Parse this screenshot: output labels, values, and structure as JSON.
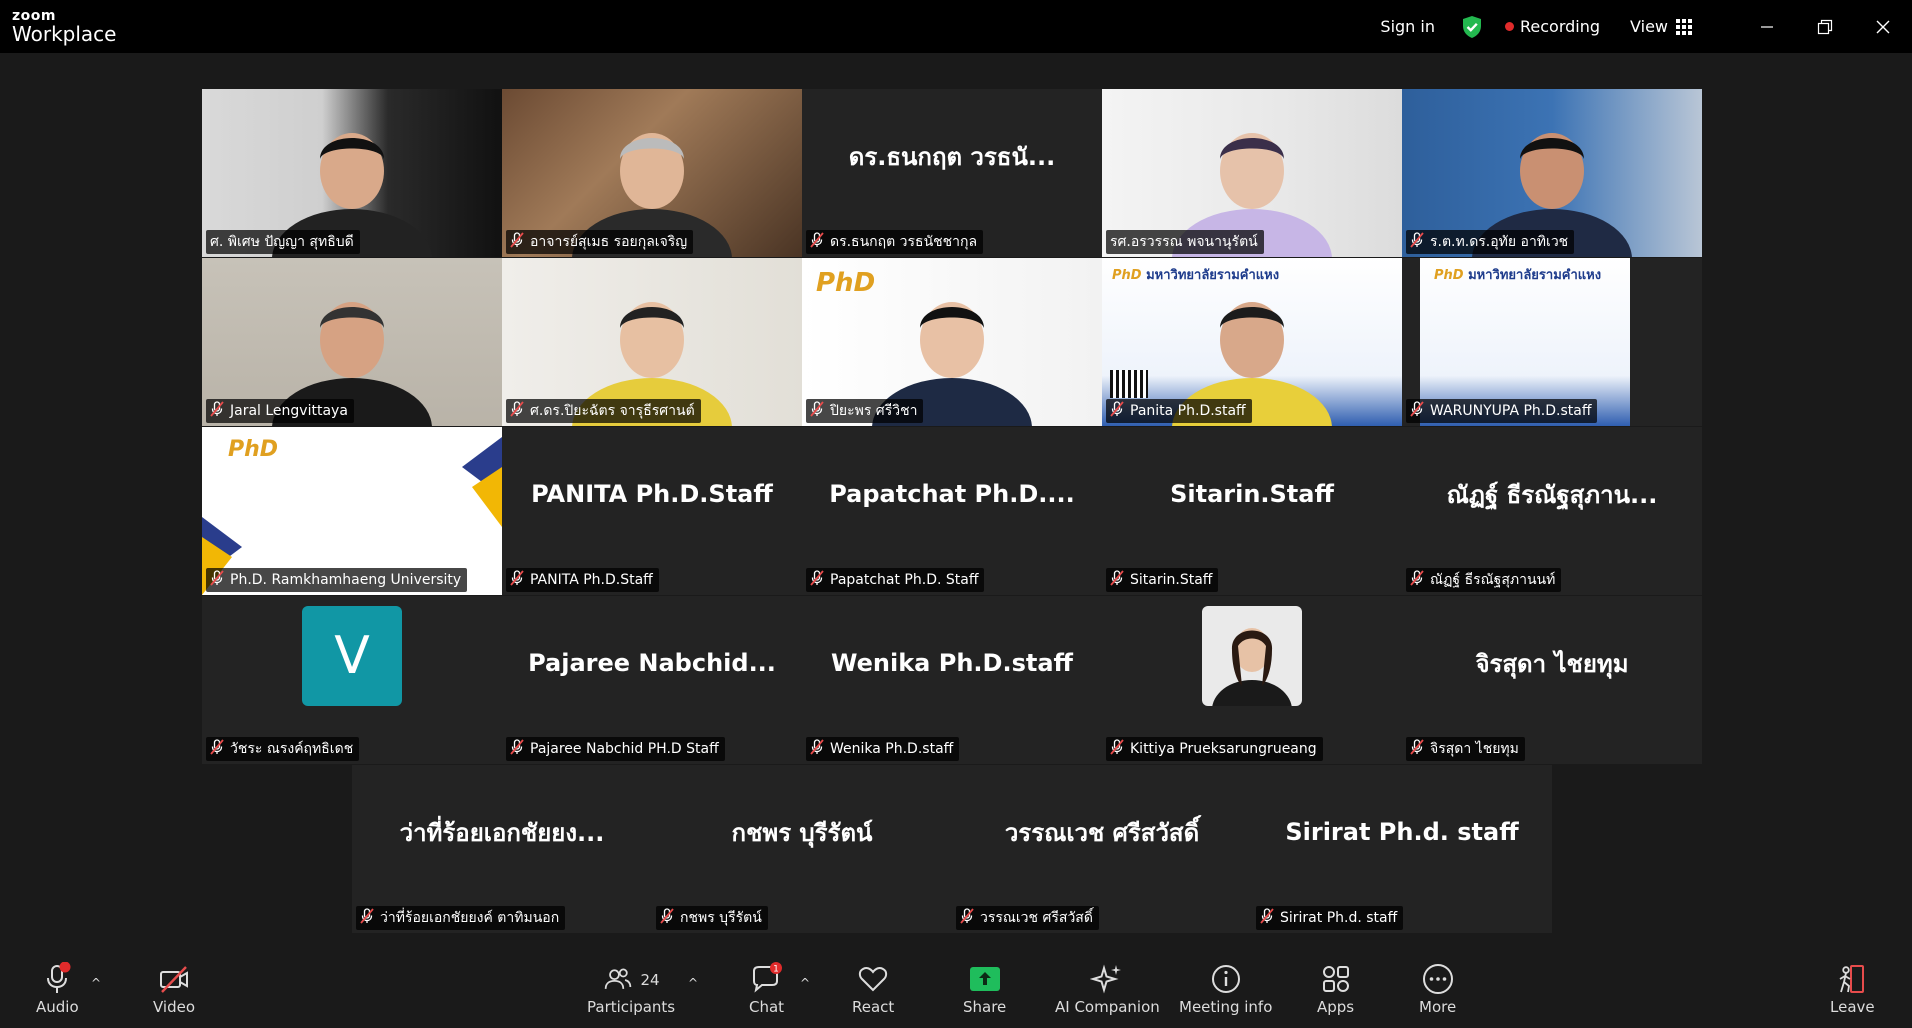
{
  "app": {
    "brand_top": "zoom",
    "brand_bottom": "Workplace"
  },
  "titlebar": {
    "sign_in": "Sign in",
    "recording": "Recording",
    "view": "View"
  },
  "tiles": [
    {
      "big": "",
      "label": "ศ. พิเศษ ปัญญา สุทธิบดี",
      "muted": false
    },
    {
      "big": "",
      "label": "อาจารย์สุเมธ รอยกุลเจริญ",
      "muted": true
    },
    {
      "big": "ดร.ธนกฤต วรธนั...",
      "label": "ดร.ธนกฤต วรธนัชชากุล",
      "muted": true
    },
    {
      "big": "",
      "label": "รศ.อรวรรณ พจนานุรัตน์",
      "muted": false
    },
    {
      "big": "",
      "label": "ร.ต.ท.ดร.อุทัย อาทิเวช",
      "muted": true
    },
    {
      "big": "",
      "label": "Jaral Lengvittaya",
      "muted": true
    },
    {
      "big": "",
      "label": "ศ.ดร.ปิยะฉัตร จารุธีรศานต์",
      "muted": true
    },
    {
      "big": "",
      "label": "ปิยะพร ศรีวิชา",
      "muted": true
    },
    {
      "big": "",
      "label": "Panita Ph.D.staff",
      "muted": true
    },
    {
      "big": "",
      "label": "WARUNYUPA Ph.D.staff",
      "muted": true
    },
    {
      "big": "",
      "label": "Ph.D. Ramkhamhaeng University",
      "muted": true
    },
    {
      "big": "PANITA Ph.D.Staff",
      "label": "PANITA Ph.D.Staff",
      "muted": true
    },
    {
      "big": "Papatchat Ph.D....",
      "label": "Papatchat Ph.D. Staff",
      "muted": true
    },
    {
      "big": "Sitarin.Staff",
      "label": "Sitarin.Staff",
      "muted": true
    },
    {
      "big": "ณัฏฐ์ ธีรณัฐสุภาน...",
      "label": "ณัฏฐ์ ธีรณัฐสุภานนท์",
      "muted": true
    },
    {
      "big": "V",
      "label": "วัชระ ณรงค์ฤทธิเดช",
      "muted": true
    },
    {
      "big": "Pajaree Nabchid...",
      "label": "Pajaree Nabchid PH.D Staff",
      "muted": true
    },
    {
      "big": "Wenika Ph.D.staff",
      "label": "Wenika Ph.D.staff",
      "muted": true
    },
    {
      "big": "",
      "label": "Kittiya Prueksarungrueang",
      "muted": true
    },
    {
      "big": "จิรสุดา ไชยทุม",
      "label": "จิรสุดา ไชยทุม",
      "muted": true
    },
    {
      "big": "ว่าที่ร้อยเอกชัยยง...",
      "label": "ว่าที่ร้อยเอกชัยยงค์ ตาทิมนอก",
      "muted": true
    },
    {
      "big": "กชพร บุรีรัตน์",
      "label": "กชพร บุรีรัตน์",
      "muted": true
    },
    {
      "big": "วรรณเวช ศรีสวัสดิ์",
      "label": "วรรณเวช ศรีสวัสดิ์",
      "muted": true
    },
    {
      "big": "Sirirat Ph.d. staff",
      "label": "Sirirat Ph.d. staff",
      "muted": true
    }
  ],
  "slide": {
    "brand": "PhD",
    "title": "มหาวิทยาลัยรามคำแหง"
  },
  "toolbar": {
    "audio": "Audio",
    "video": "Video",
    "participants": "Participants",
    "participants_count": "24",
    "chat": "Chat",
    "chat_badge": "1",
    "react": "React",
    "share": "Share",
    "ai_companion": "AI Companion",
    "meeting_info": "Meeting info",
    "apps": "Apps",
    "more": "More",
    "leave": "Leave"
  },
  "colors": {
    "accent_green": "#2ed47a",
    "recording_red": "#e02b2b",
    "share_green": "#1fbd5c",
    "muted_red": "#e74c4c",
    "avatar_teal": "#1197a5"
  }
}
